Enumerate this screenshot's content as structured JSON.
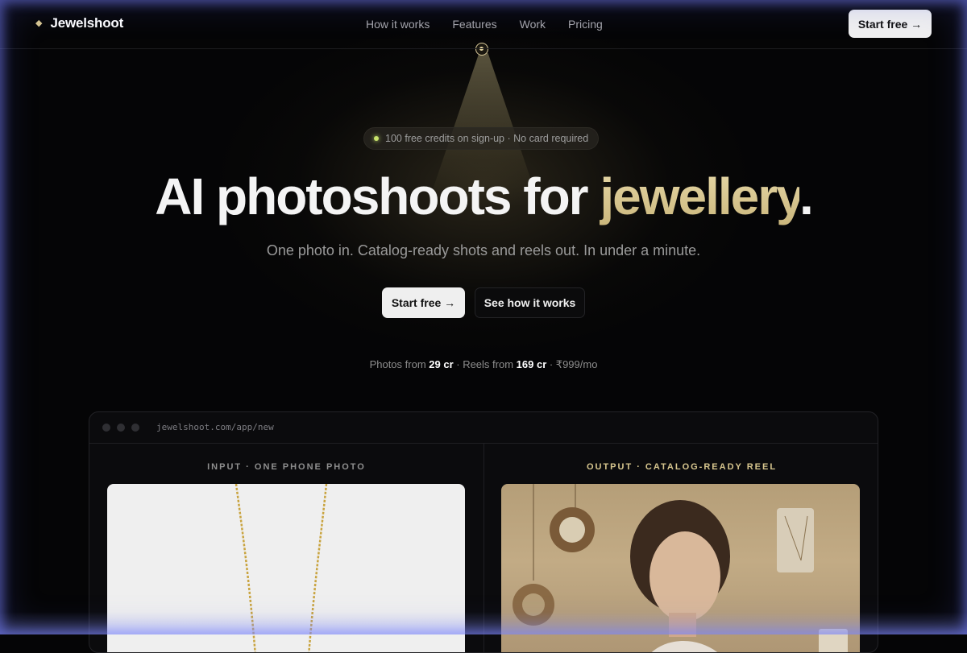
{
  "brand": {
    "logo_mark": "◆",
    "name": "Jewelshoot"
  },
  "nav": {
    "links": [
      "How it works",
      "Features",
      "Work",
      "Pricing"
    ],
    "cta": "Start free →"
  },
  "hero": {
    "badge": "100 free credits on sign-up · No card required",
    "title_main": "AI photoshoots for ",
    "title_accent": "jewellery",
    "title_end": ".",
    "subtitle": "One photo in. Catalog-ready shots and reels out. In under a minute.",
    "primary_cta": "Start free →",
    "secondary_cta": "See how it works",
    "pricing": {
      "photos_prefix": "Photos from ",
      "photos_value": "29 cr",
      "reels_prefix": " · Reels from ",
      "reels_value": "169 cr",
      "monthly": " · ₹999/mo"
    }
  },
  "app_preview": {
    "url": "jewelshoot.com/app/new",
    "input_label": "INPUT · ONE PHONE PHOTO",
    "output_label": "OUTPUT · CATALOG-READY REEL"
  },
  "colors": {
    "background": "#050506",
    "accent_gold": "#dccc94",
    "badge_dot": "#c8e36c",
    "button_light": "#efefef"
  }
}
